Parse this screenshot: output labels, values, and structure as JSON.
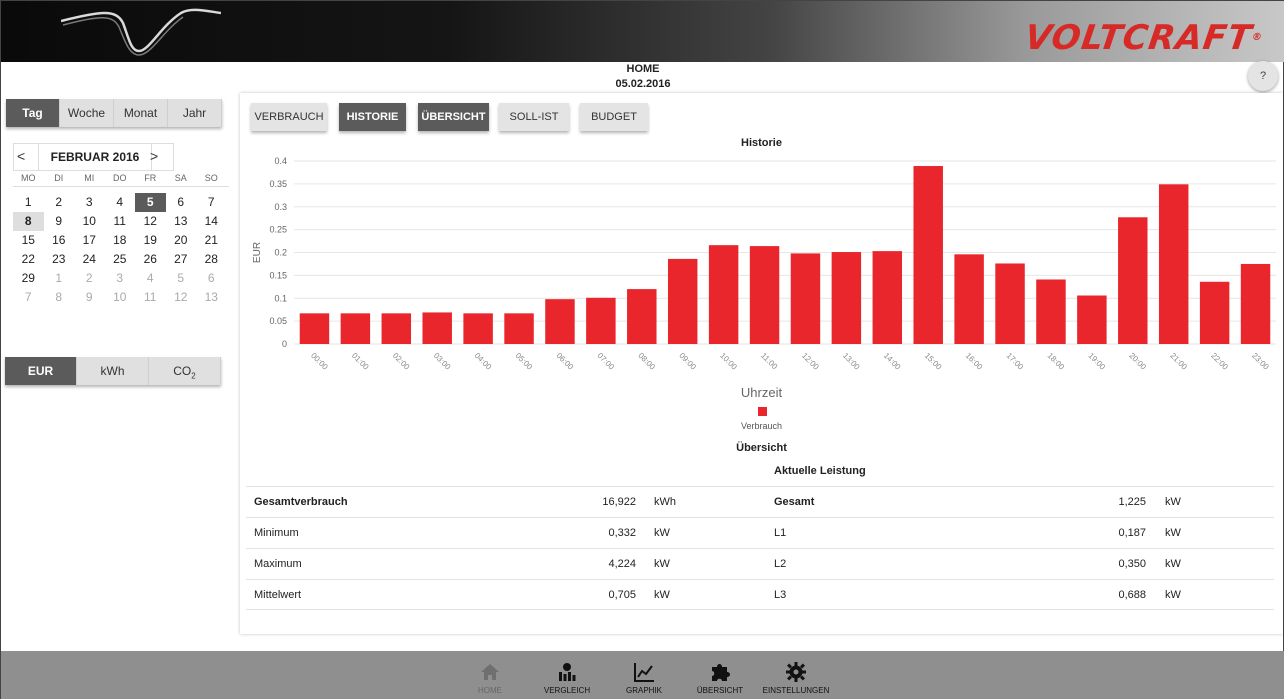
{
  "header": {
    "brand": "VOLTCRAFT",
    "brand_mark": "®"
  },
  "page": {
    "title": "HOME",
    "date": "05.02.2016",
    "help_label": "?"
  },
  "period_tabs": [
    {
      "label": "Tag",
      "active": true
    },
    {
      "label": "Woche",
      "active": false
    },
    {
      "label": "Monat",
      "active": false
    },
    {
      "label": "Jahr",
      "active": false
    }
  ],
  "calendar": {
    "prev": "<",
    "next": ">",
    "month": "FEBRUAR 2016",
    "weekdays": [
      "MO",
      "DI",
      "MI",
      "DO",
      "FR",
      "SA",
      "SO"
    ],
    "weeks": [
      [
        {
          "d": "1"
        },
        {
          "d": "2"
        },
        {
          "d": "3"
        },
        {
          "d": "4"
        },
        {
          "d": "5",
          "sel": true
        },
        {
          "d": "6"
        },
        {
          "d": "7"
        }
      ],
      [
        {
          "d": "8",
          "today": true
        },
        {
          "d": "9"
        },
        {
          "d": "10"
        },
        {
          "d": "11"
        },
        {
          "d": "12"
        },
        {
          "d": "13"
        },
        {
          "d": "14"
        }
      ],
      [
        {
          "d": "15"
        },
        {
          "d": "16"
        },
        {
          "d": "17"
        },
        {
          "d": "18"
        },
        {
          "d": "19"
        },
        {
          "d": "20"
        },
        {
          "d": "21"
        }
      ],
      [
        {
          "d": "22"
        },
        {
          "d": "23"
        },
        {
          "d": "24"
        },
        {
          "d": "25"
        },
        {
          "d": "26"
        },
        {
          "d": "27"
        },
        {
          "d": "28"
        }
      ],
      [
        {
          "d": "29"
        },
        {
          "d": "1",
          "muted": true
        },
        {
          "d": "2",
          "muted": true
        },
        {
          "d": "3",
          "muted": true
        },
        {
          "d": "4",
          "muted": true
        },
        {
          "d": "5",
          "muted": true
        },
        {
          "d": "6",
          "muted": true
        }
      ],
      [
        {
          "d": "7",
          "muted": true
        },
        {
          "d": "8",
          "muted": true
        },
        {
          "d": "9",
          "muted": true
        },
        {
          "d": "10",
          "muted": true
        },
        {
          "d": "11",
          "muted": true
        },
        {
          "d": "12",
          "muted": true
        },
        {
          "d": "13",
          "muted": true
        }
      ]
    ]
  },
  "unit_tabs": [
    {
      "label": "EUR",
      "active": true
    },
    {
      "label": "kWh",
      "active": false
    },
    {
      "label": "CO",
      "sub": "2",
      "active": false
    }
  ],
  "view_buttons": [
    {
      "label": "VERBRAUCH",
      "active": false
    },
    {
      "label": "HISTORIE",
      "active": true
    },
    {
      "label": "ÜBERSICHT",
      "active": true
    },
    {
      "label": "SOLL-IST",
      "active": false
    },
    {
      "label": "BUDGET",
      "active": false
    }
  ],
  "colors": {
    "bar": "#e8262b",
    "brand": "#d72a26",
    "active_tab": "#5b5b5b"
  },
  "chart_data": {
    "type": "bar",
    "title": "Historie",
    "xlabel": "Uhrzeit",
    "ylabel": "EUR",
    "ylim": [
      0,
      0.4
    ],
    "yticks": [
      "0",
      "0.05",
      "0.1",
      "0.15",
      "0.2",
      "0.25",
      "0.3",
      "0.35",
      "0.4"
    ],
    "grid": true,
    "legend_position": "bottom-center",
    "categories": [
      "00:00",
      "01:00",
      "02:00",
      "03:00",
      "04:00",
      "05:00",
      "06:00",
      "07:00",
      "08:00",
      "09:00",
      "10:00",
      "11:00",
      "12:00",
      "13:00",
      "14:00",
      "15:00",
      "16:00",
      "17:00",
      "18:00",
      "19:00",
      "20:00",
      "21:00",
      "22:00",
      "23:00"
    ],
    "series": [
      {
        "name": "Verbrauch",
        "values": [
          0.067,
          0.067,
          0.067,
          0.069,
          0.067,
          0.067,
          0.098,
          0.101,
          0.12,
          0.186,
          0.216,
          0.214,
          0.198,
          0.201,
          0.203,
          0.389,
          0.196,
          0.176,
          0.141,
          0.106,
          0.277,
          0.349,
          0.136,
          0.175
        ]
      }
    ]
  },
  "overview": {
    "title": "Übersicht",
    "power_title": "Aktuelle Leistung",
    "rows": [
      {
        "l1": "Gesamtverbrauch",
        "v1": "16,922",
        "u1": "kWh",
        "l2": "Gesamt",
        "v2": "1,225",
        "u2": "kW"
      },
      {
        "l1": "Minimum",
        "v1": "0,332",
        "u1": "kW",
        "l2": "L1",
        "v2": "0,187",
        "u2": "kW"
      },
      {
        "l1": "Maximum",
        "v1": "4,224",
        "u1": "kW",
        "l2": "L2",
        "v2": "0,350",
        "u2": "kW"
      },
      {
        "l1": "Mittelwert",
        "v1": "0,705",
        "u1": "kW",
        "l2": "L3",
        "v2": "0,688",
        "u2": "kW"
      }
    ]
  },
  "bottom_nav": [
    {
      "label": "HOME",
      "icon": "home-icon",
      "disabled": true
    },
    {
      "label": "VERGLEICH",
      "icon": "compare-icon",
      "disabled": false
    },
    {
      "label": "GRAPHIK",
      "icon": "chart-icon",
      "disabled": false
    },
    {
      "label": "ÜBERSICHT",
      "icon": "puzzle-icon",
      "disabled": false
    },
    {
      "label": "EINSTELLUNGEN",
      "icon": "gear-icon",
      "disabled": false
    }
  ]
}
